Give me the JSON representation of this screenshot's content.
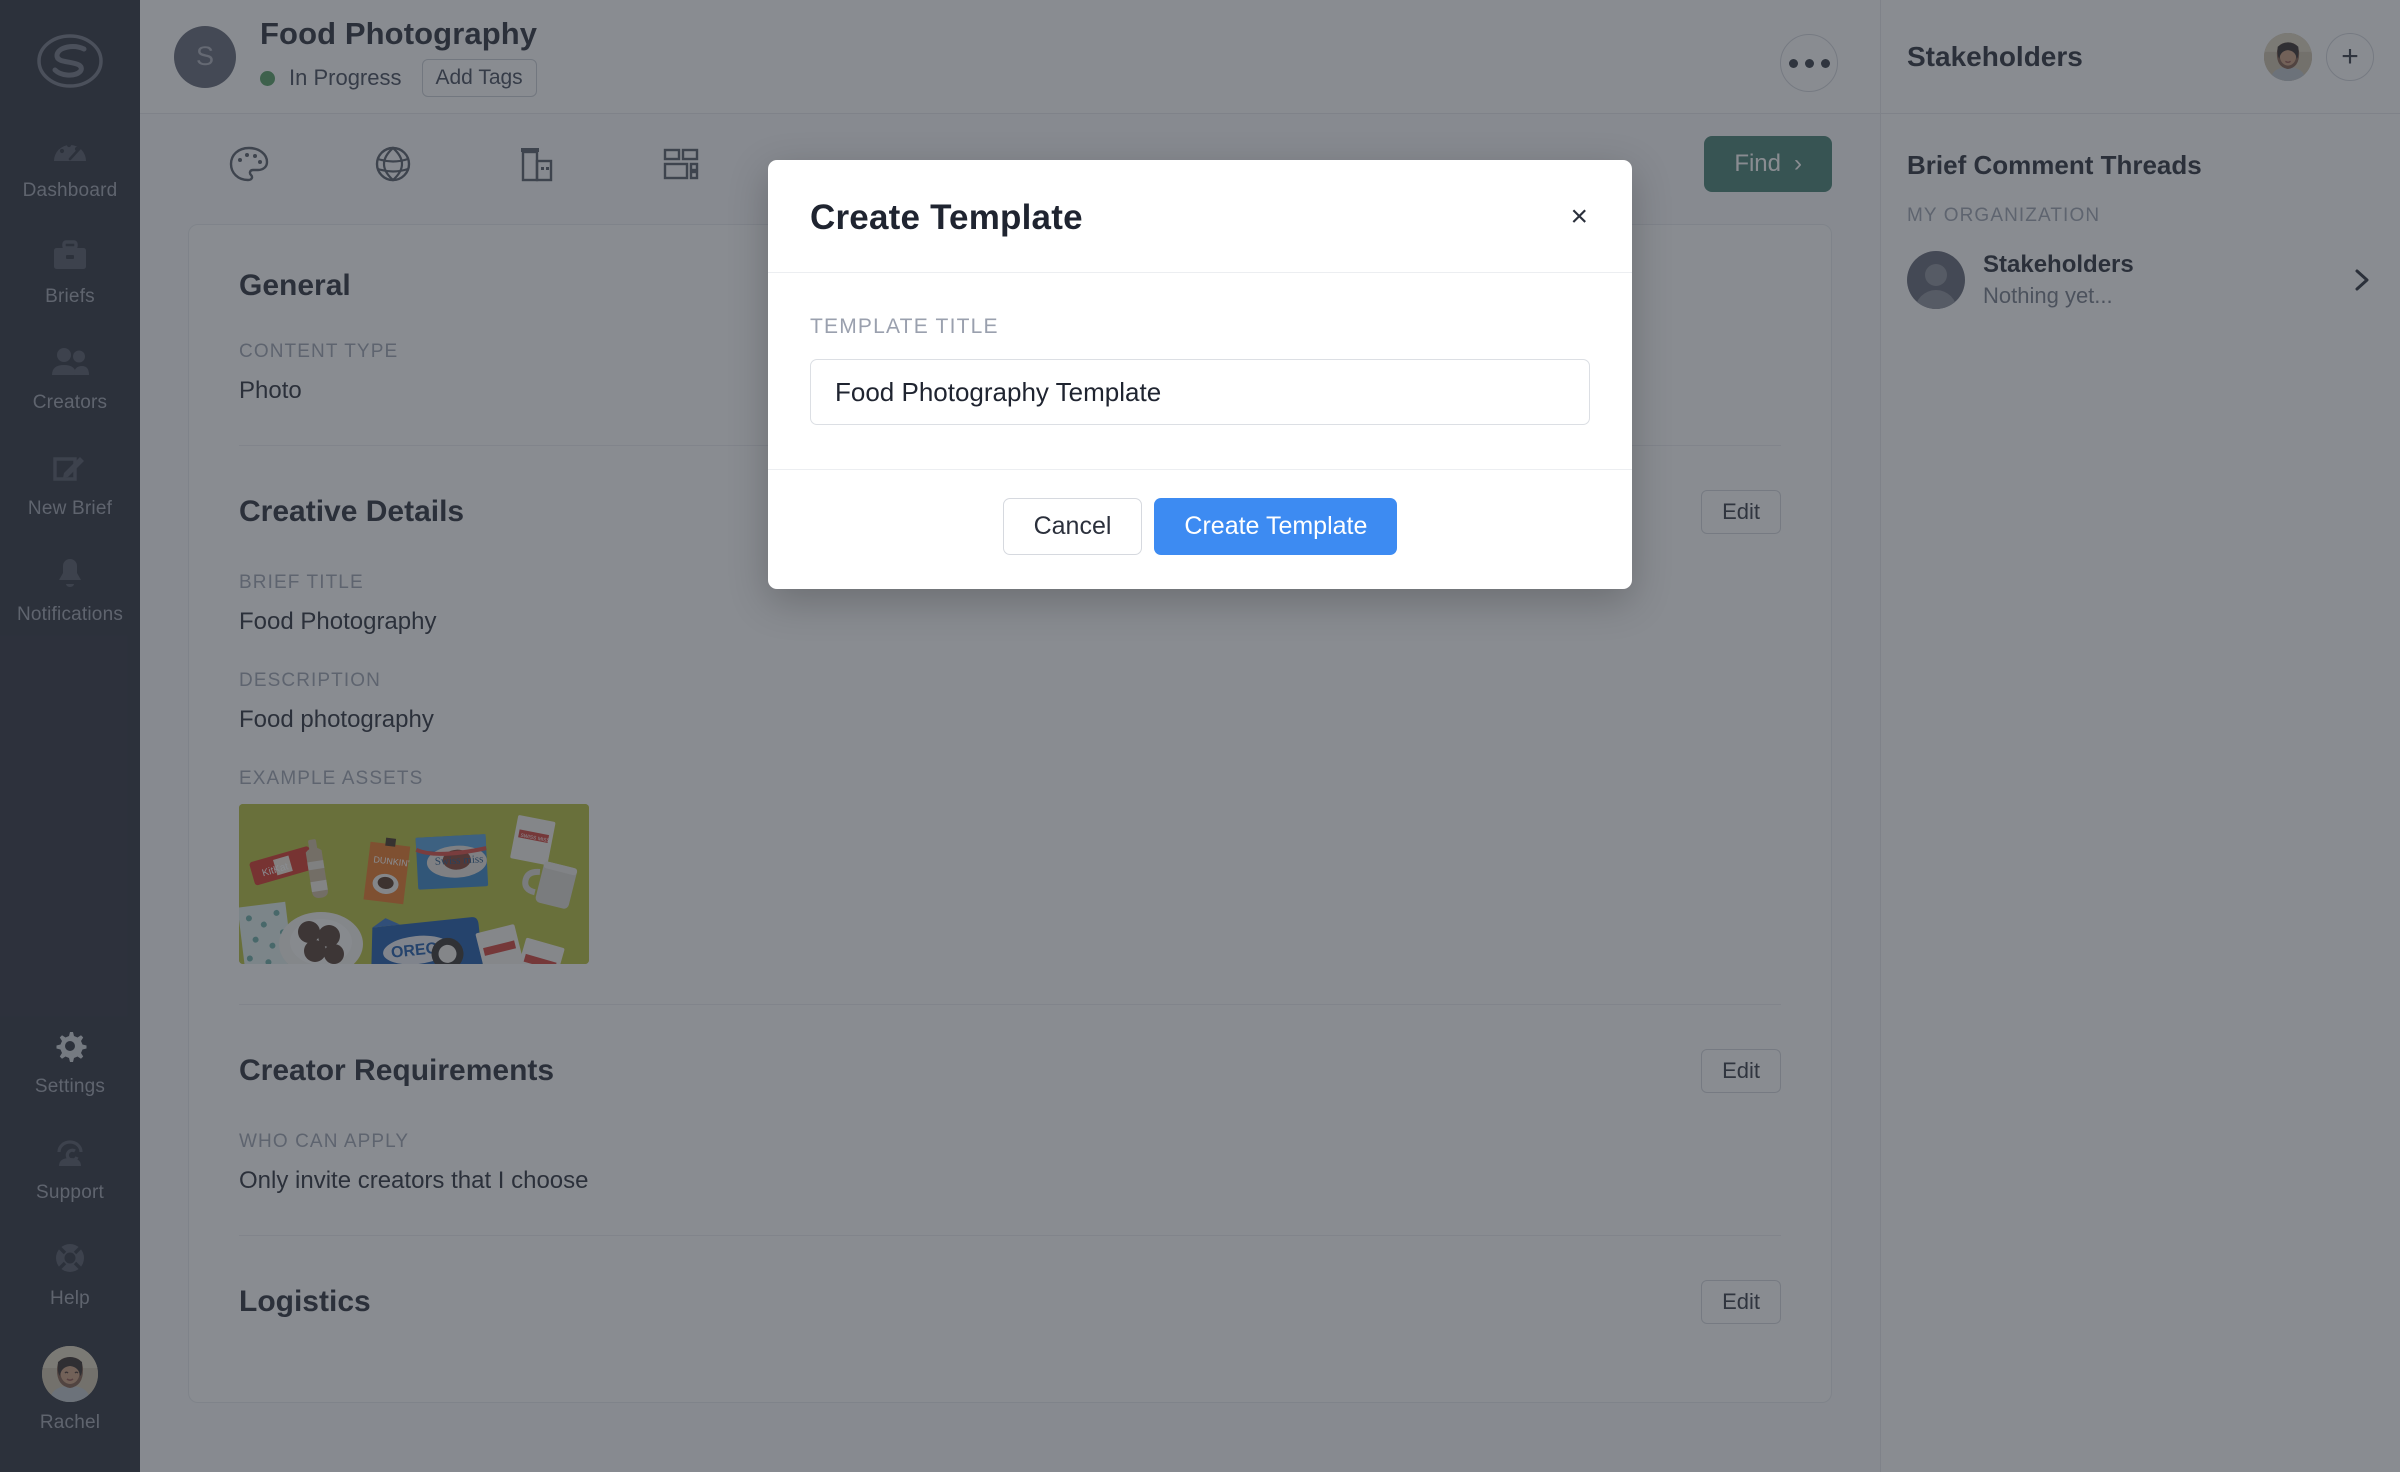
{
  "sidebar": {
    "logo_icon": "skeepers-s-logo",
    "items": [
      {
        "label": "Dashboard",
        "icon": "dashboard-gauge-icon"
      },
      {
        "label": "Briefs",
        "icon": "briefcase-icon"
      },
      {
        "label": "Creators",
        "icon": "people-icon"
      },
      {
        "label": "New Brief",
        "icon": "edit-square-pencil-icon"
      },
      {
        "label": "Notifications",
        "icon": "bell-icon"
      }
    ],
    "bottom_items": [
      {
        "label": "Settings",
        "icon": "gear-icon"
      },
      {
        "label": "Support",
        "icon": "headset-support-icon"
      },
      {
        "label": "Help",
        "icon": "lifebuoy-icon"
      }
    ],
    "user": {
      "label": "Rachel",
      "icon": "user-avatar"
    }
  },
  "header": {
    "avatar_initial": "S",
    "title": "Food Photography",
    "status": "In Progress",
    "status_color": "#4c9a5b",
    "add_tags_label": "Add Tags",
    "more_menu_icon": "ellipsis-icon"
  },
  "toolbar": {
    "icons": [
      "palette-icon",
      "globe-icon",
      "buildings-icon",
      "layout-grid-icon"
    ],
    "find_label": "Find",
    "find_chevron": "chevron-right-icon",
    "find_color": "#3d7a6b"
  },
  "main": {
    "sections": [
      {
        "title": "General",
        "edit_label": null,
        "fields": [
          {
            "label": "CONTENT TYPE",
            "value": "Photo"
          }
        ]
      },
      {
        "title": "Creative Details",
        "edit_label": "Edit",
        "fields": [
          {
            "label": "BRIEF TITLE",
            "value": "Food Photography"
          },
          {
            "label": "DESCRIPTION",
            "value": "Food photography"
          },
          {
            "label": "EXAMPLE ASSETS",
            "value": ""
          }
        ]
      },
      {
        "title": "Creator Requirements",
        "edit_label": "Edit",
        "fields": [
          {
            "label": "WHO CAN APPLY",
            "value": "Only invite creators that I choose"
          }
        ]
      },
      {
        "title": "Logistics",
        "edit_label": "Edit",
        "fields": []
      }
    ],
    "example_asset_alt": "food-flatlay-snack-products-photo"
  },
  "right_panel": {
    "title": "Stakeholders",
    "avatar_icon": "user-avatar",
    "add_icon": "plus-icon",
    "comment_threads_title": "Brief Comment Threads",
    "group_label": "MY ORGANIZATION",
    "threads": [
      {
        "name": "Stakeholders",
        "preview": "Nothing yet...",
        "avatar_icon": "user-placeholder-avatar",
        "chevron": "chevron-right-icon"
      }
    ]
  },
  "modal": {
    "title": "Create Template",
    "close_label": "×",
    "field_label": "TEMPLATE TITLE",
    "input_value": "Food Photography Template",
    "input_placeholder": "Template title",
    "cancel_label": "Cancel",
    "submit_label": "Create Template",
    "submit_color": "#3d8bf2"
  }
}
